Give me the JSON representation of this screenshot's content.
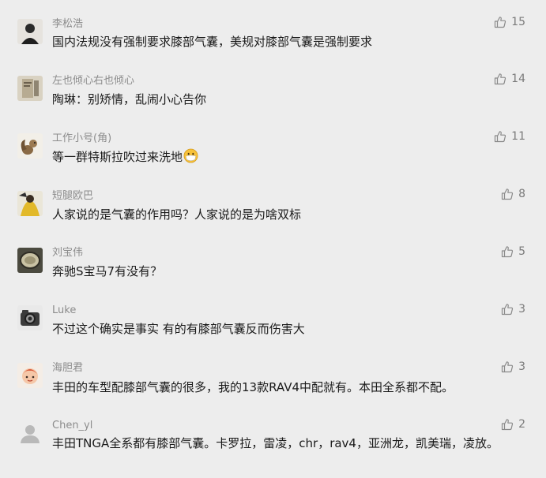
{
  "comments": [
    {
      "avatar": "avatar-person-dark-icon",
      "nickname": "李松浩",
      "text": "国内法规没有强制要求膝部气囊，美规对膝部气囊是强制要求",
      "likes": "15"
    },
    {
      "avatar": "avatar-book-icon",
      "nickname": "左也倾心右也倾心",
      "text": "陶琳：别矫情，乱闹小心告你",
      "likes": "14"
    },
    {
      "avatar": "avatar-squirrel-icon",
      "nickname": "工作小号(角)",
      "text": "等一群特斯拉吹过来洗地",
      "emoji": "face-with-medical-mask-emoji",
      "likes": "11"
    },
    {
      "avatar": "avatar-yellow-figure-icon",
      "nickname": "短腿欧巴",
      "text": "人家说的是气囊的作用吗？人家说的是为啥双标",
      "likes": "8"
    },
    {
      "avatar": "avatar-mirror-icon",
      "nickname": "刘宝伟",
      "text": "奔驰S宝马7有没有？",
      "likes": "5"
    },
    {
      "avatar": "avatar-camera-icon",
      "nickname": "Luke",
      "text": "不过这个确实是事实 有的有膝部气囊反而伤害大",
      "likes": "3"
    },
    {
      "avatar": "avatar-cartoon-icon",
      "nickname": "海胆君",
      "text": "丰田的车型配膝部气囊的很多，我的13款RAV4中配就有。本田全系都不配。",
      "likes": "3"
    },
    {
      "avatar": "avatar-default-user-icon",
      "nickname": "Chen_yl",
      "text": "丰田TNGA全系都有膝部气囊。卡罗拉，雷凌，chr，rav4，亚洲龙，凯美瑞，凌放。",
      "likes": "2"
    }
  ],
  "colors": {
    "background": "#ededed",
    "nickname": "#8c8c8c",
    "text": "#1a1a1a",
    "like": "#7a7a7a"
  }
}
